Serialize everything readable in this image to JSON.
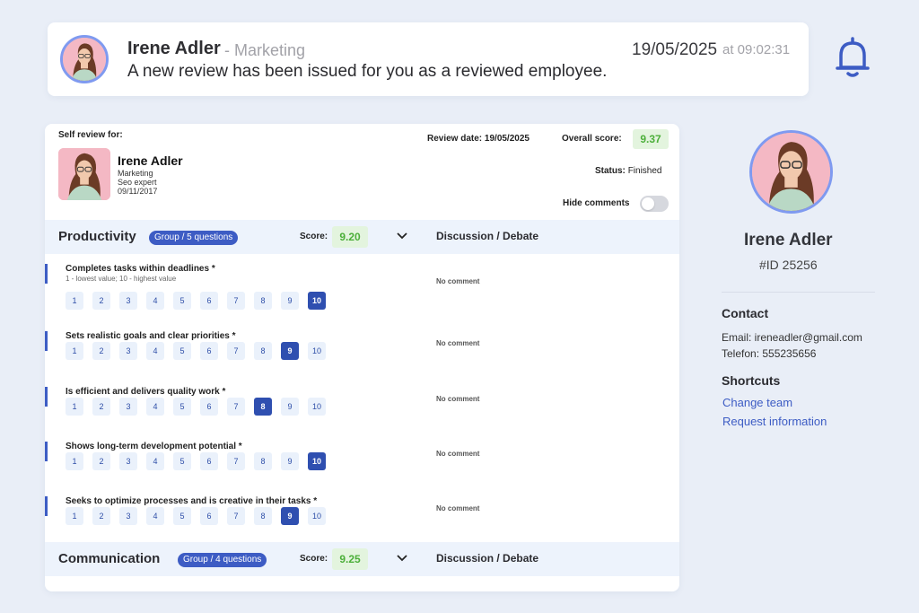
{
  "notification": {
    "name": "Irene Adler",
    "department": "- Marketing",
    "message": "A new review has been issued for you as a reviewed employee.",
    "date": "19/05/2025",
    "time": "at 09:02:31"
  },
  "review": {
    "label": "Self review for:",
    "employee": {
      "name": "Irene Adler",
      "department": "Marketing",
      "role": "Seo expert",
      "date": "09/11/2017"
    },
    "review_date": "Review date: 19/05/2025",
    "overall_label": "Overall score:",
    "overall_score": "9.37",
    "status_label": "Status:",
    "status_value": "Finished",
    "hide_comments_label": "Hide comments",
    "hide_comments_on": false
  },
  "groups": [
    {
      "title": "Productivity",
      "pill": "Group / 5 questions",
      "score_label": "Score:",
      "score": "9.20",
      "discussion": "Discussion / Debate",
      "expanded": true,
      "questions": [
        {
          "title": "Completes tasks within deadlines *",
          "hint": "1 - lowest value; 10 - highest value",
          "selected": 10,
          "comment": "No comment"
        },
        {
          "title": "Sets realistic goals and clear priorities *",
          "hint": "",
          "selected": 9,
          "comment": "No comment"
        },
        {
          "title": "Is efficient and delivers quality work *",
          "hint": "",
          "selected": 8,
          "comment": "No comment"
        },
        {
          "title": "Shows long-term development potential *",
          "hint": "",
          "selected": 10,
          "comment": "No comment"
        },
        {
          "title": "Seeks to optimize processes and is creative in their tasks *",
          "hint": "",
          "selected": 9,
          "comment": "No comment"
        }
      ]
    },
    {
      "title": "Communication",
      "pill": "Group / 4 questions",
      "score_label": "Score:",
      "score": "9.25",
      "discussion": "Discussion / Debate",
      "expanded": false
    }
  ],
  "scale": [
    "1",
    "2",
    "3",
    "4",
    "5",
    "6",
    "7",
    "8",
    "9",
    "10"
  ],
  "profile": {
    "name": "Irene Adler",
    "id": "#ID 25256",
    "contact_heading": "Contact",
    "email": "Email: ireneadler@gmail.com",
    "phone": "Telefon: 555235656",
    "shortcuts_heading": "Shortcuts",
    "shortcuts": [
      "Change team",
      "Request information"
    ]
  },
  "icons": {
    "bell": "bell-icon",
    "chevron": "chevron-down-icon",
    "avatar": "user-avatar"
  },
  "colors": {
    "accent": "#3d5cc4",
    "score_bg": "#e3f4de",
    "score_text": "#4caf3a",
    "group_bar": "#edf3fc",
    "background": "#e9eef7"
  }
}
